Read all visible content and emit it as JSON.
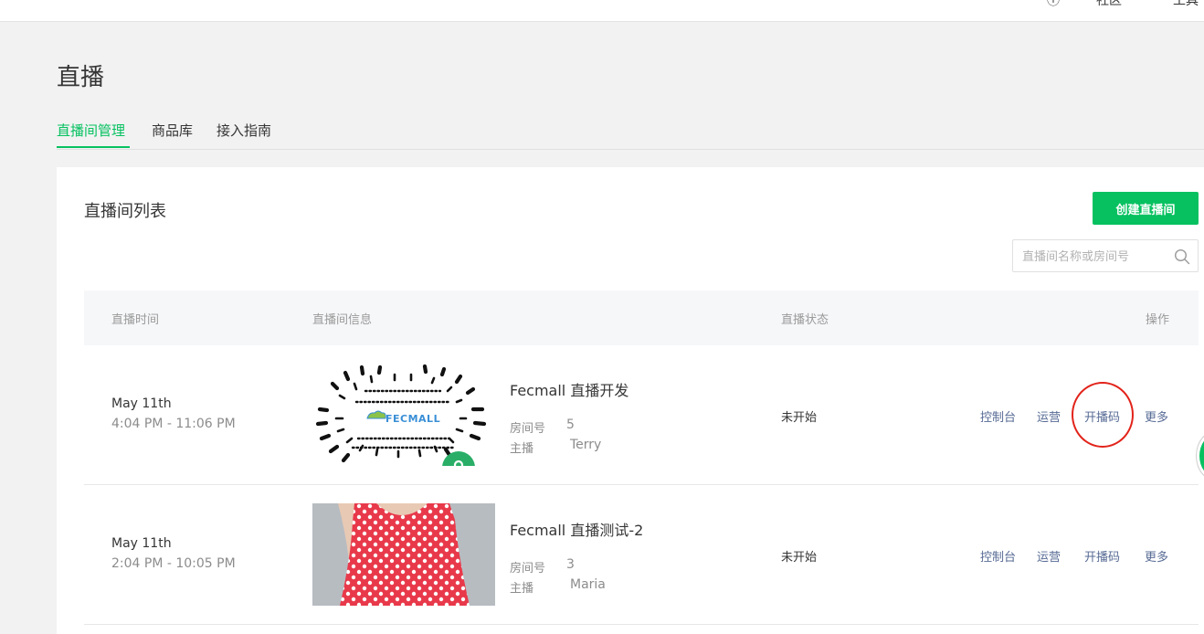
{
  "header": {
    "partial_items": [
      "ⓘ",
      "社区",
      "工具"
    ]
  },
  "page": {
    "title": "直播"
  },
  "tabs": [
    {
      "label": "直播间管理",
      "active": true
    },
    {
      "label": "商品库",
      "active": false
    },
    {
      "label": "接入指南",
      "active": false
    }
  ],
  "list": {
    "title": "直播间列表",
    "create_button": "创建直播间",
    "search_placeholder": "直播间名称或房间号",
    "columns": [
      "直播时间",
      "直播间信息",
      "直播状态",
      "操作"
    ],
    "rows": [
      {
        "date": "May 11th",
        "time_range": "4:04 PM - 11:06 PM",
        "thumbnail": "qr-code",
        "thumbnail_logo_text": "FECMALL",
        "name": "Fecmall 直播开发",
        "room_label": "房间号",
        "room_no": "5",
        "host_label": "主播",
        "host": "Terry",
        "status": "未开始",
        "actions": [
          "控制台",
          "运营",
          "开播码",
          "更多"
        ]
      },
      {
        "date": "May 11th",
        "time_range": "2:04 PM - 10:05 PM",
        "thumbnail": "polka-dot-dress-photo",
        "name": "Fecmall 直播测试-2",
        "room_label": "房间号",
        "room_no": "3",
        "host_label": "主播",
        "host": "Maria",
        "status": "未开始",
        "actions": [
          "控制台",
          "运营",
          "开播码",
          "更多"
        ]
      }
    ]
  },
  "colors": {
    "accent": "#07c160",
    "link": "#576b95",
    "highlight_circle": "#e2231a"
  },
  "icons": [
    "search-icon",
    "miniprogram-badge-icon"
  ]
}
